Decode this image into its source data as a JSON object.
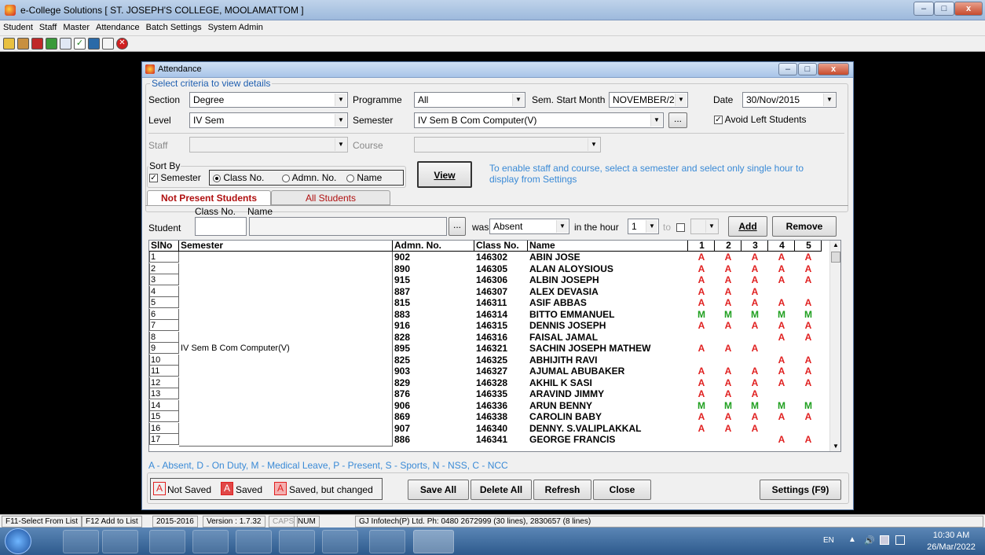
{
  "app": {
    "title": "e-College Solutions [ ST. JOSEPH'S COLLEGE, MOOLAMATTOM ]"
  },
  "window_controls": {
    "minimize": "–",
    "maximize": "□",
    "close": "x"
  },
  "menu": [
    "Student",
    "Staff",
    "Master",
    "Attendance",
    "Batch Settings",
    "System Admin"
  ],
  "toolbar_icons": [
    "book-icon",
    "people-icon",
    "pdf-icon",
    "group-icon",
    "search-icon",
    "check-icon",
    "calculator-icon",
    "user-icon",
    "close-icon"
  ],
  "dialog": {
    "title": "Attendance",
    "criteria_legend": "Select criteria to view details",
    "section_label": "Section",
    "section_value": "Degree",
    "programme_label": "Programme",
    "programme_value": "All",
    "sem_start_label": "Sem. Start Month",
    "sem_start_value": "NOVEMBER/2",
    "date_label": "Date",
    "date_value": "30/Nov/2015",
    "level_label": "Level",
    "level_value": "IV Sem",
    "semester_label": "Semester",
    "semester_value": "IV Sem B Com Computer(V)",
    "browse": "...",
    "avoid_left": "Avoid Left Students",
    "staff_label": "Staff",
    "course_label": "Course",
    "sortby_legend": "Sort By",
    "sort_semester": "Semester",
    "sort_classno": "Class No.",
    "sort_admno": "Admn. No.",
    "sort_name": "Name",
    "view_button": "View",
    "hint": "To enable staff and course, select a semester and select only single hour to display from Settings",
    "tab_not_present": "Not Present Students",
    "tab_all": "All Students",
    "classno_label": "Class No.",
    "name_label": "Name",
    "student_label": "Student",
    "was_label": "was",
    "status_value": "Absent",
    "hour_label": "in the hour",
    "hour_value": "1",
    "to_label": "to",
    "add_button": "Add",
    "remove_button": "Remove",
    "legend_text": "A - Absent, D - On Duty, M - Medical Leave, P - Present, S - Sports, N - NSS, C - NCC",
    "not_saved": "Not Saved",
    "saved": "Saved",
    "saved_changed": "Saved, but changed",
    "save_all": "Save All",
    "delete_all": "Delete All",
    "refresh": "Refresh",
    "close": "Close",
    "settings": "Settings (F9)"
  },
  "grid": {
    "headers": {
      "slno": "SlNo",
      "semester": "Semester",
      "admn": "Admn. No.",
      "classno": "Class No.",
      "name": "Name",
      "h1": "1",
      "h2": "2",
      "h3": "3",
      "h4": "4",
      "h5": "5"
    },
    "semester_merged": "IV Sem B Com Computer(V)",
    "rows": [
      {
        "sl": "1",
        "admn": "902",
        "classno": "146302",
        "name": "ABIN JOSE",
        "h": [
          "A",
          "A",
          "A",
          "A",
          "A"
        ]
      },
      {
        "sl": "2",
        "admn": "890",
        "classno": "146305",
        "name": "ALAN ALOYSIOUS",
        "h": [
          "A",
          "A",
          "A",
          "A",
          "A"
        ]
      },
      {
        "sl": "3",
        "admn": "915",
        "classno": "146306",
        "name": "ALBIN JOSEPH",
        "h": [
          "A",
          "A",
          "A",
          "A",
          "A"
        ]
      },
      {
        "sl": "4",
        "admn": "887",
        "classno": "146307",
        "name": "ALEX DEVASIA",
        "h": [
          "A",
          "A",
          "A",
          "",
          ""
        ]
      },
      {
        "sl": "5",
        "admn": "815",
        "classno": "146311",
        "name": "ASIF ABBAS",
        "h": [
          "A",
          "A",
          "A",
          "A",
          "A"
        ]
      },
      {
        "sl": "6",
        "admn": "883",
        "classno": "146314",
        "name": "BITTO EMMANUEL",
        "h": [
          "M",
          "M",
          "M",
          "M",
          "M"
        ]
      },
      {
        "sl": "7",
        "admn": "916",
        "classno": "146315",
        "name": "DENNIS JOSEPH",
        "h": [
          "A",
          "A",
          "A",
          "A",
          "A"
        ]
      },
      {
        "sl": "8",
        "admn": "828",
        "classno": "146316",
        "name": "FAISAL JAMAL",
        "h": [
          "",
          "",
          "",
          "A",
          "A"
        ]
      },
      {
        "sl": "9",
        "admn": "895",
        "classno": "146321",
        "name": "SACHIN JOSEPH MATHEW",
        "h": [
          "A",
          "A",
          "A",
          "",
          ""
        ]
      },
      {
        "sl": "10",
        "admn": "825",
        "classno": "146325",
        "name": "ABHIJITH RAVI",
        "h": [
          "",
          "",
          "",
          "A",
          "A"
        ]
      },
      {
        "sl": "11",
        "admn": "903",
        "classno": "146327",
        "name": "AJUMAL ABUBAKER",
        "h": [
          "A",
          "A",
          "A",
          "A",
          "A"
        ]
      },
      {
        "sl": "12",
        "admn": "829",
        "classno": "146328",
        "name": "AKHIL K SASI",
        "h": [
          "A",
          "A",
          "A",
          "A",
          "A"
        ]
      },
      {
        "sl": "13",
        "admn": "876",
        "classno": "146335",
        "name": "ARAVIND JIMMY",
        "h": [
          "A",
          "A",
          "A",
          "",
          ""
        ]
      },
      {
        "sl": "14",
        "admn": "906",
        "classno": "146336",
        "name": "ARUN BENNY",
        "h": [
          "M",
          "M",
          "M",
          "M",
          "M"
        ]
      },
      {
        "sl": "15",
        "admn": "869",
        "classno": "146338",
        "name": "CAROLIN BABY",
        "h": [
          "A",
          "A",
          "A",
          "A",
          "A"
        ]
      },
      {
        "sl": "16",
        "admn": "907",
        "classno": "146340",
        "name": "DENNY. S.VALIPLAKKAL",
        "h": [
          "A",
          "A",
          "A",
          "",
          ""
        ]
      },
      {
        "sl": "17",
        "admn": "886",
        "classno": "146341",
        "name": "GEORGE FRANCIS",
        "h": [
          "",
          "",
          "",
          "A",
          "A"
        ]
      }
    ]
  },
  "status": {
    "f11": "F11-Select From List",
    "f12": "F12 Add to List",
    "year": "2015-2016",
    "version": "Version : 1.7.32",
    "caps": "CAPS",
    "num": "NUM",
    "company": "GJ Infotech(P) Ltd. Ph: 0480 2672999 (30 lines), 2830657 (8 lines)"
  },
  "taskbar": {
    "lang": "EN",
    "time": "10:30 AM",
    "date": "26/Mar/2022"
  },
  "colors": {
    "absent": "#e02020",
    "medical": "#20a020",
    "hint": "#3a8ad6"
  }
}
